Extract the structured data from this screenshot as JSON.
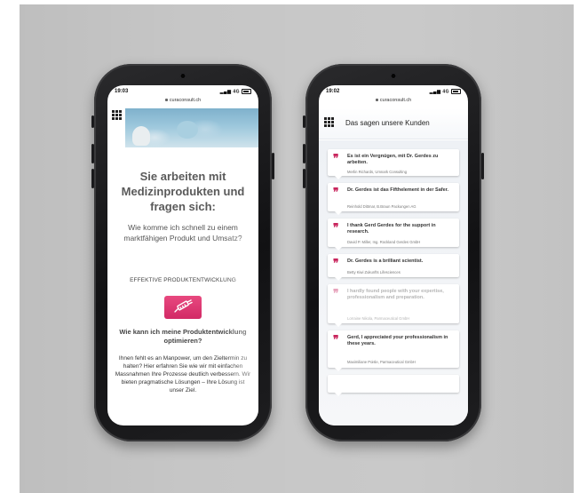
{
  "left_phone": {
    "time": "19:03",
    "signal": "4G",
    "url": "curaconsult.ch",
    "headline": [
      "Sie arbeiten mit",
      "Medizinprodukten und",
      "fragen sich:"
    ],
    "question": "Wie komme ich schnell zu einem marktfähigen Produkt und Umsatz?",
    "subhead": "EFFEKTIVE PRODUKTENTWICKLUNG",
    "q2": "Wie kann ich meine Produktentwicklung optimieren?",
    "body": "Ihnen fehlt es an Manpower, um den Zieltermin zu halten? Hier erfahren Sie wie wir mit einfachen Massnahmen Ihre Prozesse deutlich verbessern. Wir bieten pragmatische Lösungen – Ihre Lösung ist unser Ziel."
  },
  "right_phone": {
    "time": "19:02",
    "signal": "4G",
    "url": "curaconsult.ch",
    "title": "Das sagen unsere Kunden",
    "testimonials": [
      {
        "quote": "Es ist ein Vergnügen, mit Dr. Gerdes zu arbeiten.",
        "author": "Merlin Richards, Umnark Consulting"
      },
      {
        "quote": "Dr. Gerdes ist das Fifthelement in der Safer.",
        "author": "Reinhold Dittmar, B.Braun Packungen AG"
      },
      {
        "quote": "I thank Gerd Gerdes for the support in research.",
        "author": "David P. Miller, Ing. Rockland Gerdes GmbH"
      },
      {
        "quote": "Dr. Gerdes is a brilliant scientist.",
        "author": "Betty Kiwi Zukunfts Lifesciences"
      },
      {
        "quote": "I hardly found people with your expertise, professionalism and preparation.",
        "author": "Lorraine Nikola, Parmaceutical GmbH"
      },
      {
        "quote": "Gerd, I appreciated your professionalism in these years.",
        "author": "Maximiliane Poisle, Parmaceutical GmbH"
      }
    ]
  },
  "colors": {
    "background": "#c6c6c6",
    "accent_pink": "#d22a66",
    "quote_mark": "#c8245c"
  }
}
